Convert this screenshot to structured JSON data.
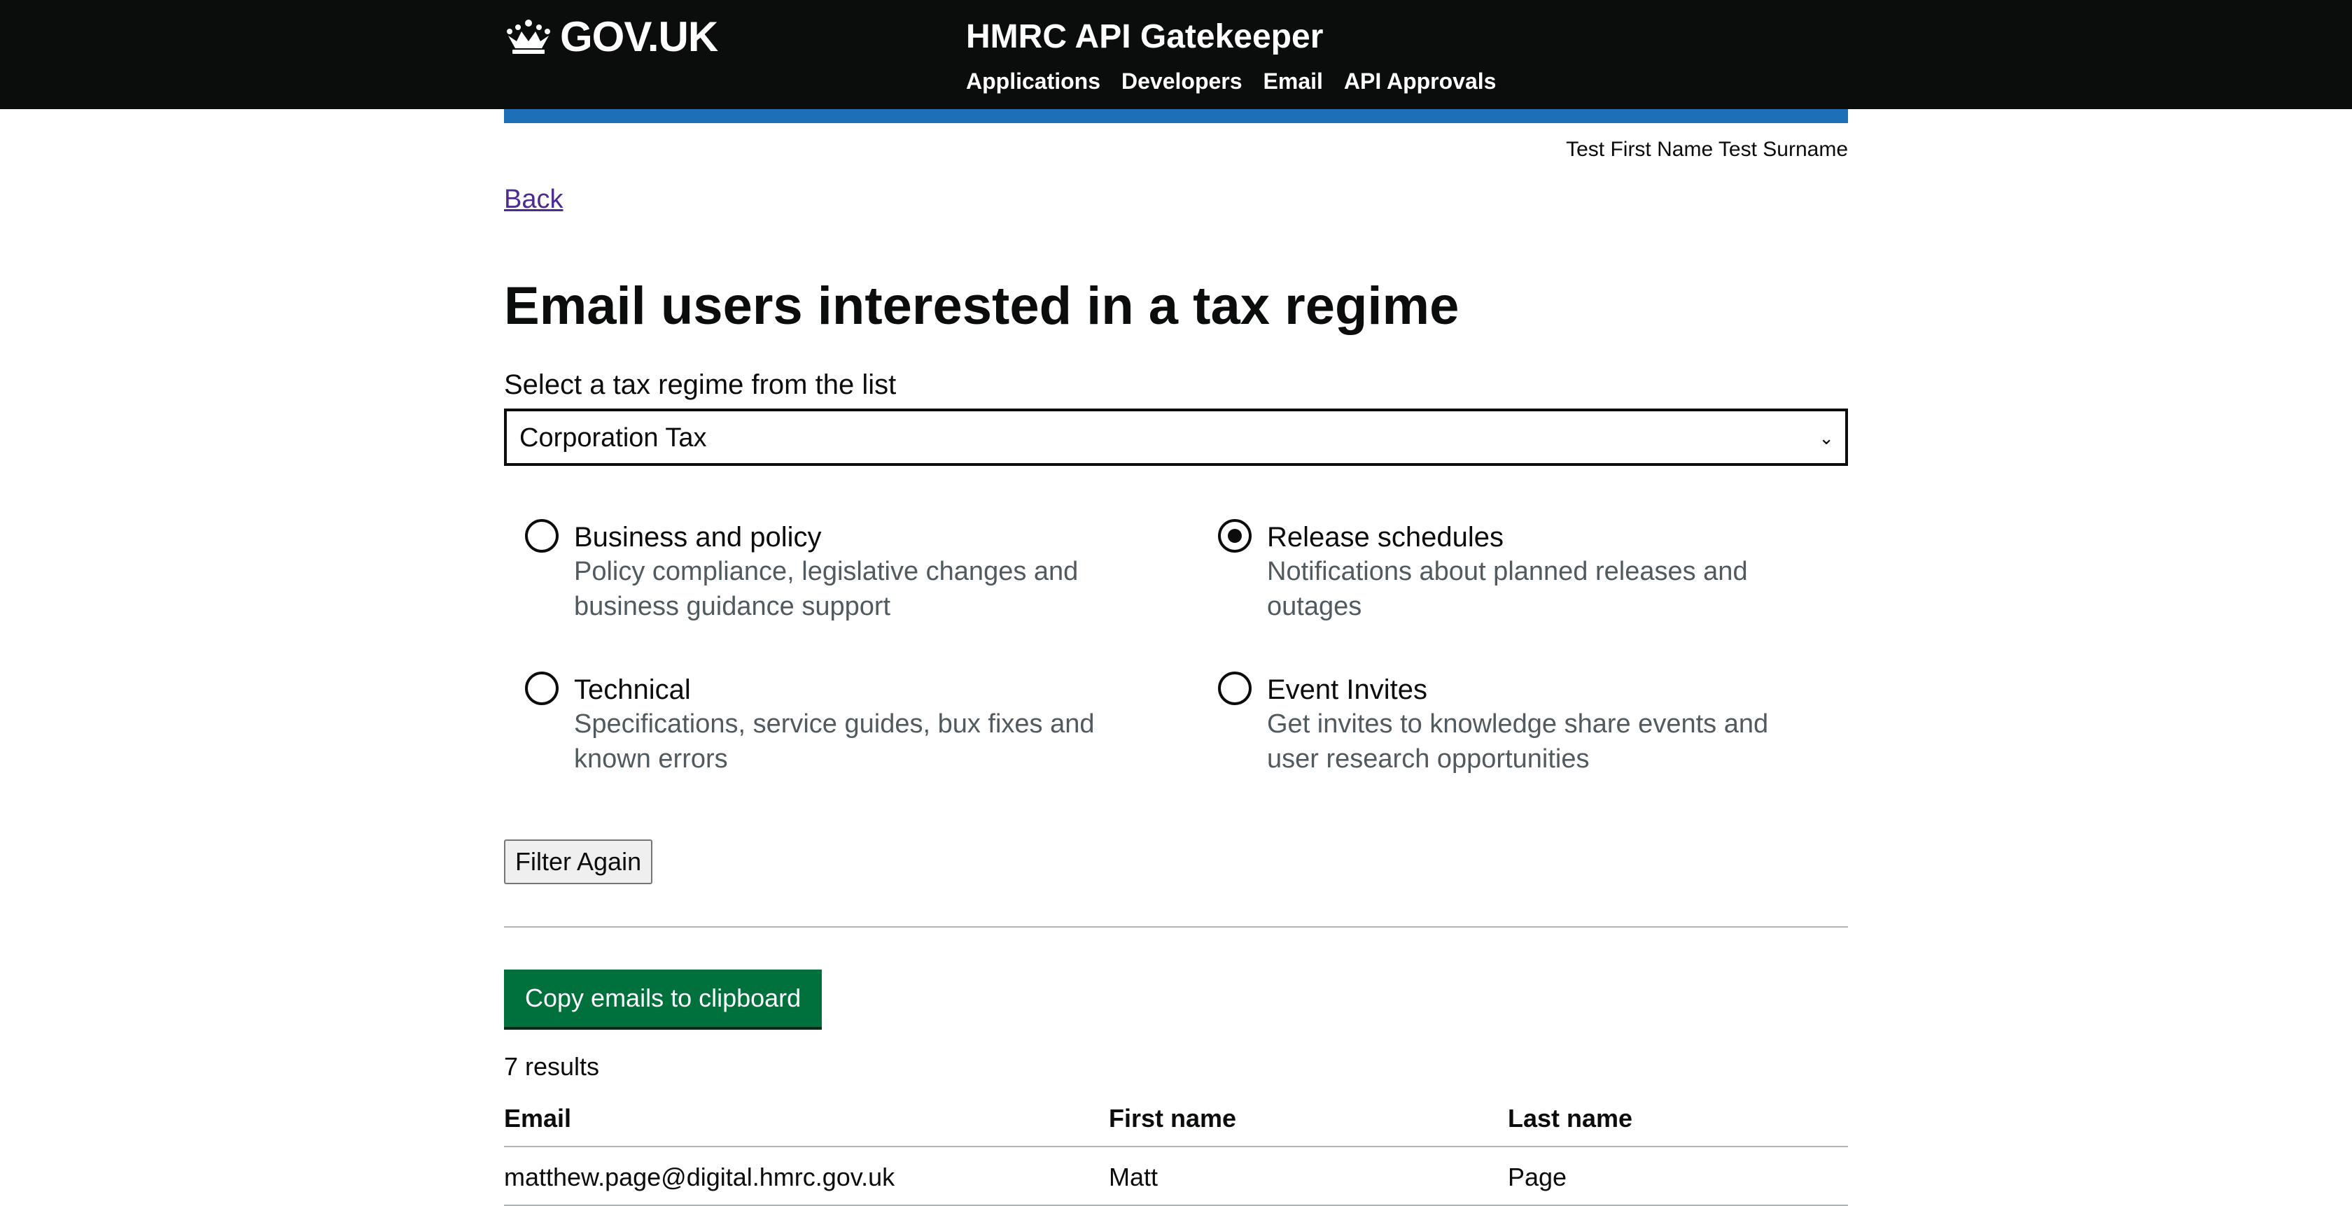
{
  "header": {
    "logo_text": "GOV.UK",
    "service_name": "HMRC API Gatekeeper",
    "nav": [
      {
        "label": "Applications"
      },
      {
        "label": "Developers"
      },
      {
        "label": "Email"
      },
      {
        "label": "API Approvals"
      }
    ]
  },
  "user": {
    "name": "Test First Name Test Surname"
  },
  "back_link": "Back",
  "page_title": "Email users interested in a tax regime",
  "tax_regime": {
    "label": "Select a tax regime from the list",
    "selected": "Corporation Tax"
  },
  "topics": [
    {
      "label": "Business and policy",
      "hint": "Policy compliance, legislative changes and business guidance support",
      "checked": false
    },
    {
      "label": "Release schedules",
      "hint": "Notifications about planned releases and outages",
      "checked": true
    },
    {
      "label": "Technical",
      "hint": "Specifications, service guides, bux fixes and known errors",
      "checked": false
    },
    {
      "label": "Event Invites",
      "hint": "Get invites to knowledge share events and user research opportunities",
      "checked": false
    }
  ],
  "filter_button": "Filter Again",
  "copy_button": "Copy emails to clipboard",
  "results_count": "7 results",
  "table": {
    "headers": {
      "email": "Email",
      "first_name": "First name",
      "last_name": "Last name"
    },
    "rows": [
      {
        "email": "matthew.page@digital.hmrc.gov.uk",
        "first_name": "Matt",
        "last_name": "Page"
      }
    ]
  },
  "colors": {
    "header_bg": "#0b0c0c",
    "accent_blue": "#1d70b8",
    "button_green": "#00703c",
    "link_visited": "#4c2c92",
    "hint_grey": "#505a5f"
  }
}
